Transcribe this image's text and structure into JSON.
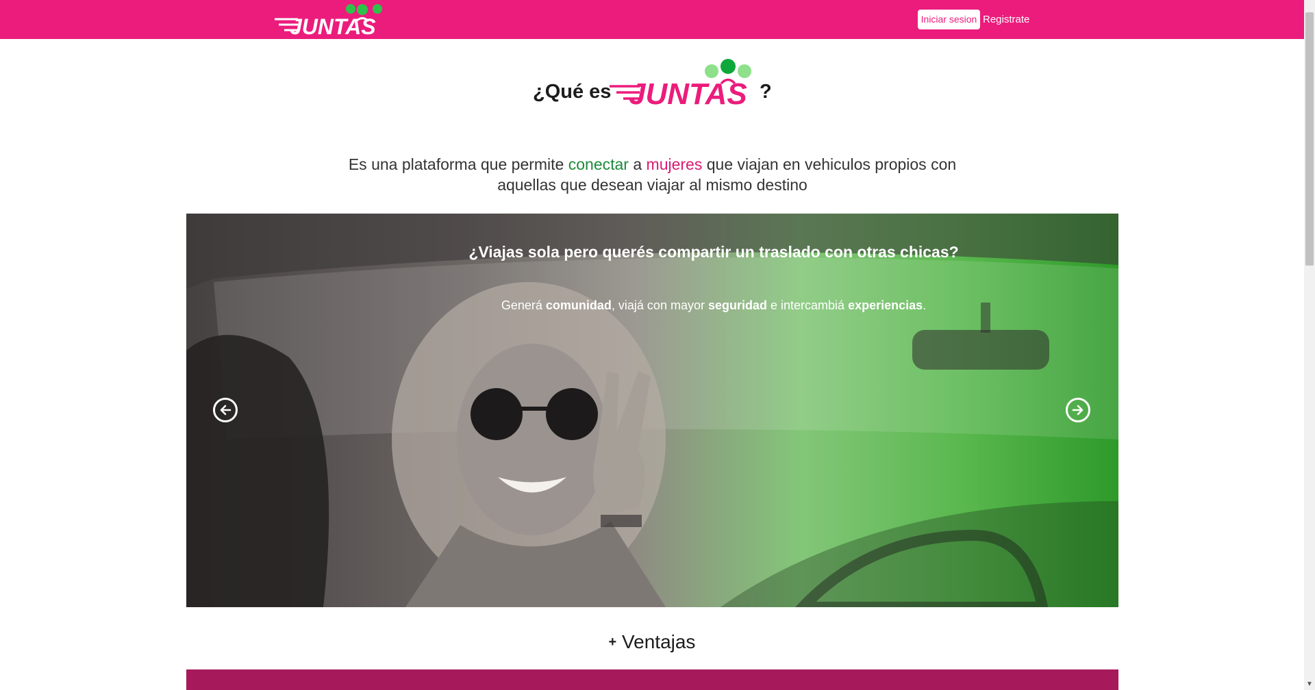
{
  "header": {
    "brand": "JUNTAS",
    "login_label": "Iniciar sesion",
    "register_label": "Registrate"
  },
  "heading": {
    "prefix": "¿Qué es",
    "brand": "JUNTAS",
    "suffix": "?"
  },
  "intro": {
    "part1": "Es una plataforma que permite ",
    "highlight1": "conectar",
    "part2": " a ",
    "highlight2": "mujeres",
    "part3": " que viajan en vehiculos propios con aquellas que desean viajar al mismo destino"
  },
  "carousel": {
    "title": "¿Viajas sola pero querés compartir un traslado con otras chicas?",
    "sub_1": "Generá ",
    "sub_bold_1": "comunidad",
    "sub_2": ", viajá con mayor ",
    "sub_bold_2": "seguridad",
    "sub_3": " e intercambiá ",
    "sub_bold_3": "experiencias",
    "sub_4": ".",
    "prev_icon": "arrow-left-circle-icon",
    "next_icon": "arrow-right-circle-icon"
  },
  "ventajas": {
    "plus": "+",
    "label": "Ventajas"
  },
  "colors": {
    "brand_pink": "#eb1c7c",
    "brand_green": "#2e9a2a",
    "light_green": "#8ee08a",
    "dark_band": "#a6195a"
  }
}
